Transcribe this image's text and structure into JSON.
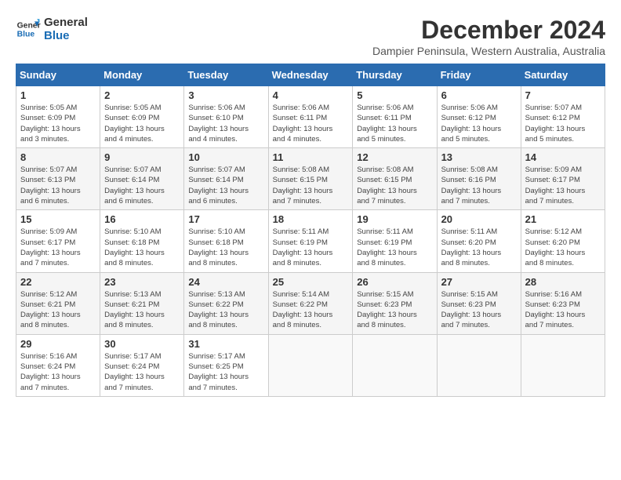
{
  "logo": {
    "line1": "General",
    "line2": "Blue"
  },
  "title": "December 2024",
  "subtitle": "Dampier Peninsula, Western Australia, Australia",
  "days_of_week": [
    "Sunday",
    "Monday",
    "Tuesday",
    "Wednesday",
    "Thursday",
    "Friday",
    "Saturday"
  ],
  "weeks": [
    [
      {
        "day": "1",
        "info": "Sunrise: 5:05 AM\nSunset: 6:09 PM\nDaylight: 13 hours\nand 3 minutes."
      },
      {
        "day": "2",
        "info": "Sunrise: 5:05 AM\nSunset: 6:09 PM\nDaylight: 13 hours\nand 4 minutes."
      },
      {
        "day": "3",
        "info": "Sunrise: 5:06 AM\nSunset: 6:10 PM\nDaylight: 13 hours\nand 4 minutes."
      },
      {
        "day": "4",
        "info": "Sunrise: 5:06 AM\nSunset: 6:11 PM\nDaylight: 13 hours\nand 4 minutes."
      },
      {
        "day": "5",
        "info": "Sunrise: 5:06 AM\nSunset: 6:11 PM\nDaylight: 13 hours\nand 5 minutes."
      },
      {
        "day": "6",
        "info": "Sunrise: 5:06 AM\nSunset: 6:12 PM\nDaylight: 13 hours\nand 5 minutes."
      },
      {
        "day": "7",
        "info": "Sunrise: 5:07 AM\nSunset: 6:12 PM\nDaylight: 13 hours\nand 5 minutes."
      }
    ],
    [
      {
        "day": "8",
        "info": "Sunrise: 5:07 AM\nSunset: 6:13 PM\nDaylight: 13 hours\nand 6 minutes."
      },
      {
        "day": "9",
        "info": "Sunrise: 5:07 AM\nSunset: 6:14 PM\nDaylight: 13 hours\nand 6 minutes."
      },
      {
        "day": "10",
        "info": "Sunrise: 5:07 AM\nSunset: 6:14 PM\nDaylight: 13 hours\nand 6 minutes."
      },
      {
        "day": "11",
        "info": "Sunrise: 5:08 AM\nSunset: 6:15 PM\nDaylight: 13 hours\nand 7 minutes."
      },
      {
        "day": "12",
        "info": "Sunrise: 5:08 AM\nSunset: 6:15 PM\nDaylight: 13 hours\nand 7 minutes."
      },
      {
        "day": "13",
        "info": "Sunrise: 5:08 AM\nSunset: 6:16 PM\nDaylight: 13 hours\nand 7 minutes."
      },
      {
        "day": "14",
        "info": "Sunrise: 5:09 AM\nSunset: 6:17 PM\nDaylight: 13 hours\nand 7 minutes."
      }
    ],
    [
      {
        "day": "15",
        "info": "Sunrise: 5:09 AM\nSunset: 6:17 PM\nDaylight: 13 hours\nand 7 minutes."
      },
      {
        "day": "16",
        "info": "Sunrise: 5:10 AM\nSunset: 6:18 PM\nDaylight: 13 hours\nand 8 minutes."
      },
      {
        "day": "17",
        "info": "Sunrise: 5:10 AM\nSunset: 6:18 PM\nDaylight: 13 hours\nand 8 minutes."
      },
      {
        "day": "18",
        "info": "Sunrise: 5:11 AM\nSunset: 6:19 PM\nDaylight: 13 hours\nand 8 minutes."
      },
      {
        "day": "19",
        "info": "Sunrise: 5:11 AM\nSunset: 6:19 PM\nDaylight: 13 hours\nand 8 minutes."
      },
      {
        "day": "20",
        "info": "Sunrise: 5:11 AM\nSunset: 6:20 PM\nDaylight: 13 hours\nand 8 minutes."
      },
      {
        "day": "21",
        "info": "Sunrise: 5:12 AM\nSunset: 6:20 PM\nDaylight: 13 hours\nand 8 minutes."
      }
    ],
    [
      {
        "day": "22",
        "info": "Sunrise: 5:12 AM\nSunset: 6:21 PM\nDaylight: 13 hours\nand 8 minutes."
      },
      {
        "day": "23",
        "info": "Sunrise: 5:13 AM\nSunset: 6:21 PM\nDaylight: 13 hours\nand 8 minutes."
      },
      {
        "day": "24",
        "info": "Sunrise: 5:13 AM\nSunset: 6:22 PM\nDaylight: 13 hours\nand 8 minutes."
      },
      {
        "day": "25",
        "info": "Sunrise: 5:14 AM\nSunset: 6:22 PM\nDaylight: 13 hours\nand 8 minutes."
      },
      {
        "day": "26",
        "info": "Sunrise: 5:15 AM\nSunset: 6:23 PM\nDaylight: 13 hours\nand 8 minutes."
      },
      {
        "day": "27",
        "info": "Sunrise: 5:15 AM\nSunset: 6:23 PM\nDaylight: 13 hours\nand 7 minutes."
      },
      {
        "day": "28",
        "info": "Sunrise: 5:16 AM\nSunset: 6:23 PM\nDaylight: 13 hours\nand 7 minutes."
      }
    ],
    [
      {
        "day": "29",
        "info": "Sunrise: 5:16 AM\nSunset: 6:24 PM\nDaylight: 13 hours\nand 7 minutes."
      },
      {
        "day": "30",
        "info": "Sunrise: 5:17 AM\nSunset: 6:24 PM\nDaylight: 13 hours\nand 7 minutes."
      },
      {
        "day": "31",
        "info": "Sunrise: 5:17 AM\nSunset: 6:25 PM\nDaylight: 13 hours\nand 7 minutes."
      },
      {
        "day": "",
        "info": ""
      },
      {
        "day": "",
        "info": ""
      },
      {
        "day": "",
        "info": ""
      },
      {
        "day": "",
        "info": ""
      }
    ]
  ]
}
